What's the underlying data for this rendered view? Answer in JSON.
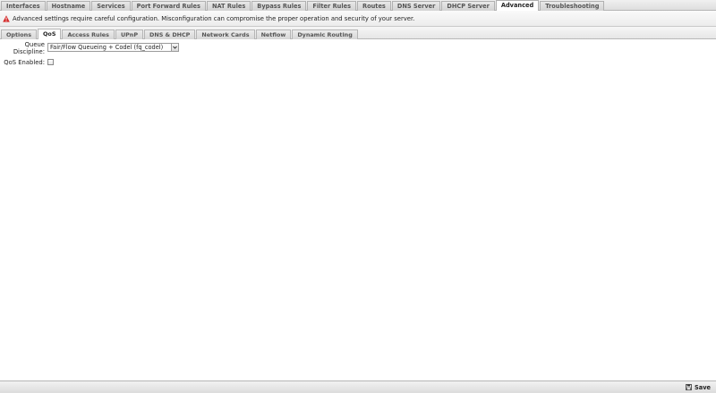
{
  "top_tabs": [
    {
      "label": "Interfaces",
      "active": false
    },
    {
      "label": "Hostname",
      "active": false
    },
    {
      "label": "Services",
      "active": false
    },
    {
      "label": "Port Forward Rules",
      "active": false
    },
    {
      "label": "NAT Rules",
      "active": false
    },
    {
      "label": "Bypass Rules",
      "active": false
    },
    {
      "label": "Filter Rules",
      "active": false
    },
    {
      "label": "Routes",
      "active": false
    },
    {
      "label": "DNS Server",
      "active": false
    },
    {
      "label": "DHCP Server",
      "active": false
    },
    {
      "label": "Advanced",
      "active": true
    },
    {
      "label": "Troubleshooting",
      "active": false
    }
  ],
  "warning": {
    "icon": "warning-icon",
    "text": "Advanced settings require careful configuration. Misconfiguration can compromise the proper operation and security of your server."
  },
  "sub_tabs": [
    {
      "label": "Options",
      "active": false
    },
    {
      "label": "QoS",
      "active": true
    },
    {
      "label": "Access Rules",
      "active": false
    },
    {
      "label": "UPnP",
      "active": false
    },
    {
      "label": "DNS & DHCP",
      "active": false
    },
    {
      "label": "Network Cards",
      "active": false
    },
    {
      "label": "Netflow",
      "active": false
    },
    {
      "label": "Dynamic Routing",
      "active": false
    }
  ],
  "form": {
    "queue_discipline_label_1": "Queue",
    "queue_discipline_label_2": "Discipline:",
    "queue_discipline_value": "Fair/Flow Queueing + Codel (fq_codel)",
    "qos_enabled_label": "QoS Enabled:",
    "qos_enabled_checked": false
  },
  "footer": {
    "save_label": "Save"
  },
  "colors": {
    "warning_red": "#d42a2a",
    "tab_border": "#b0b0b0"
  }
}
